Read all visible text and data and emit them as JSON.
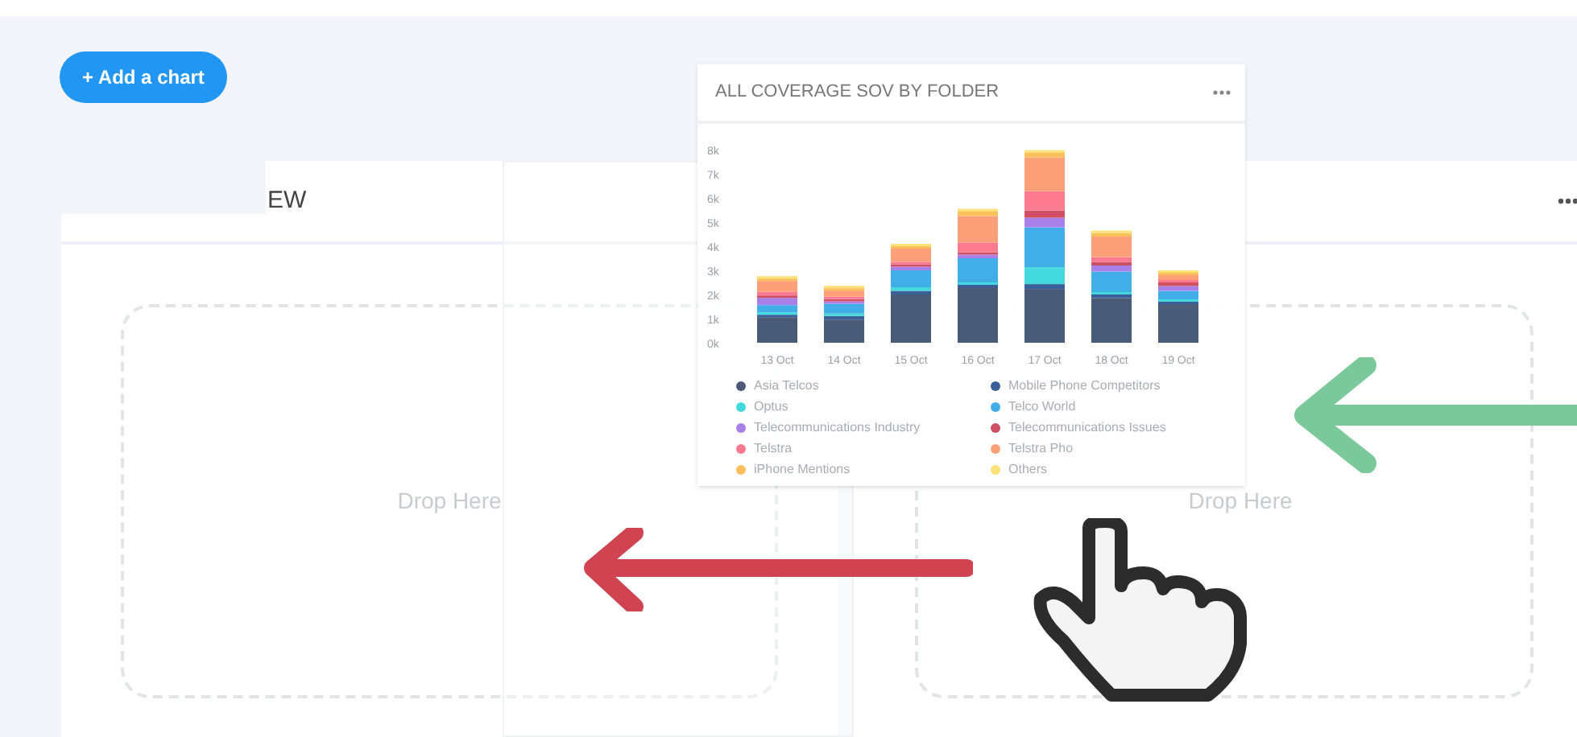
{
  "toolbar": {
    "add_button": "+ Add a chart"
  },
  "left_card": {
    "title": "EW",
    "drop_text": "Drop Here"
  },
  "right_card": {
    "drop_text": "Drop Here"
  },
  "chart_card": {
    "title": "ALL COVERAGE SOV BY FOLDER",
    "chart_data": {
      "type": "bar",
      "stacked": true,
      "categories": [
        "13 Oct",
        "14 Oct",
        "15 Oct",
        "16 Oct",
        "17 Oct",
        "18 Oct",
        "19 Oct"
      ],
      "ylim": [
        0,
        8000
      ],
      "yticks": [
        {
          "value": 0,
          "label": "0k"
        },
        {
          "value": 1000,
          "label": "1k"
        },
        {
          "value": 2000,
          "label": "2k"
        },
        {
          "value": 3000,
          "label": "3k"
        },
        {
          "value": 4000,
          "label": "4k"
        },
        {
          "value": 5000,
          "label": "5k"
        },
        {
          "value": 6000,
          "label": "6k"
        },
        {
          "value": 7000,
          "label": "7k"
        },
        {
          "value": 8000,
          "label": "8k"
        }
      ],
      "series": [
        {
          "name": "Asia Telcos",
          "color": "#4a5b78",
          "values": [
            1060,
            960,
            2000,
            2300,
            2230,
            1850,
            1600
          ]
        },
        {
          "name": "Mobile Phone Competitors",
          "color": "#3a5f9a",
          "values": [
            100,
            150,
            150,
            100,
            200,
            150,
            100
          ]
        },
        {
          "name": "Optus",
          "color": "#44d9dc",
          "values": [
            100,
            100,
            150,
            100,
            700,
            100,
            100
          ]
        },
        {
          "name": "Telco World",
          "color": "#42aee8",
          "values": [
            300,
            400,
            700,
            1000,
            1650,
            850,
            350
          ]
        },
        {
          "name": "Telecommunications Industry",
          "color": "#a97fe8",
          "values": [
            300,
            100,
            150,
            150,
            400,
            250,
            200
          ]
        },
        {
          "name": "Telecommunications Issues",
          "color": "#cf5065",
          "values": [
            100,
            100,
            100,
            100,
            300,
            150,
            150
          ]
        },
        {
          "name": "Telstra",
          "color": "#fb7a90",
          "values": [
            150,
            100,
            100,
            400,
            800,
            200,
            100
          ]
        },
        {
          "name": "Telstra Pho",
          "color": "#fda07a",
          "values": [
            450,
            250,
            550,
            1100,
            1400,
            850,
            200
          ]
        },
        {
          "name": "iPhone Mentions",
          "color": "#fdbf5a",
          "values": [
            100,
            100,
            100,
            200,
            200,
            150,
            100
          ]
        },
        {
          "name": "Others",
          "color": "#fde27a",
          "values": [
            100,
            100,
            100,
            100,
            100,
            100,
            100
          ]
        }
      ]
    }
  }
}
